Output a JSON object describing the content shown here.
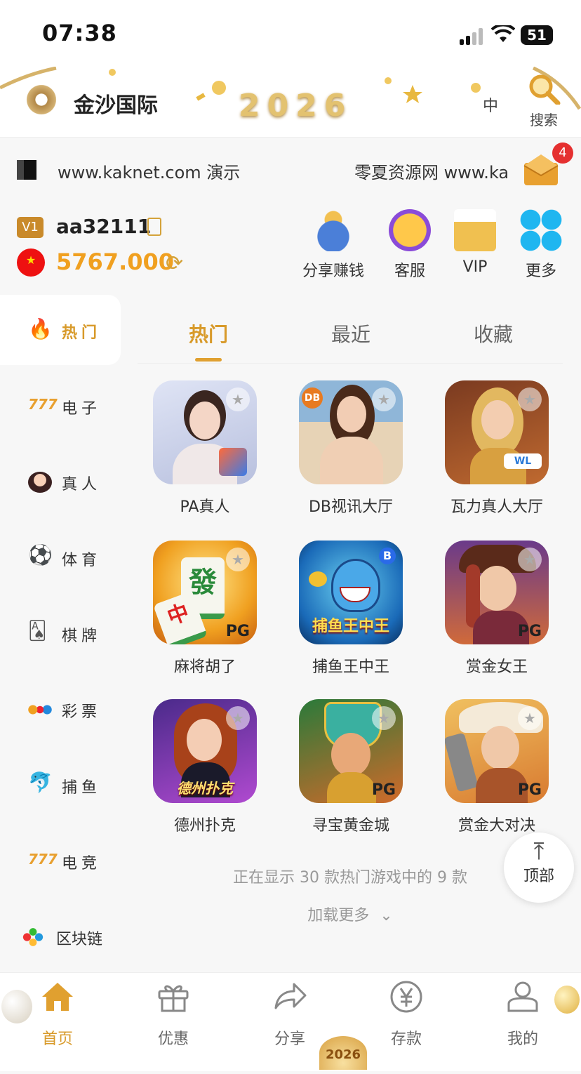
{
  "status": {
    "time": "07:38",
    "battery": "51"
  },
  "header": {
    "brand": "金沙国际",
    "badge": "2026",
    "lang": "中",
    "search_label": "搜索"
  },
  "marquee": {
    "text1": "www.kaknet.com 演示",
    "text2": "零夏资源网 www.ka",
    "mail_count": "4"
  },
  "user": {
    "level": "V1",
    "username": "aa32111",
    "balance": "5767.000"
  },
  "quick_actions": [
    {
      "label": "分享赚钱",
      "icon": "money-bag-icon"
    },
    {
      "label": "客服",
      "icon": "headset-icon"
    },
    {
      "label": "VIP",
      "icon": "crown-icon"
    },
    {
      "label": "更多",
      "icon": "clover-icon"
    }
  ],
  "sidebar": {
    "items": [
      {
        "label": "热门",
        "icon": "fire-icon"
      },
      {
        "label": "电子",
        "icon": "slot-777-icon"
      },
      {
        "label": "真人",
        "icon": "dealer-icon"
      },
      {
        "label": "体育",
        "icon": "soccer-ball-icon"
      },
      {
        "label": "棋牌",
        "icon": "cards-icon"
      },
      {
        "label": "彩票",
        "icon": "lottery-balls-icon"
      },
      {
        "label": "捕鱼",
        "icon": "fish-icon"
      },
      {
        "label": "电竞",
        "icon": "slot-777-icon"
      },
      {
        "label": "区块链",
        "icon": "blockchain-icon"
      }
    ]
  },
  "tabs": [
    {
      "label": "热门"
    },
    {
      "label": "最近"
    },
    {
      "label": "收藏"
    }
  ],
  "games": [
    {
      "name": "PA真人"
    },
    {
      "name": "DB视讯大厅"
    },
    {
      "name": "瓦力真人大厅"
    },
    {
      "name": "麻将胡了",
      "tag": "PG"
    },
    {
      "name": "捕鱼王中王"
    },
    {
      "name": "赏金女王",
      "tag": "PG"
    },
    {
      "name": "德州扑克"
    },
    {
      "name": "寻宝黄金城",
      "tag": "PG"
    },
    {
      "name": "赏金大对决",
      "tag": "PG"
    }
  ],
  "game_count_info": "正在显示 30 款热门游戏中的 9 款",
  "load_more": "加载更多",
  "back_to_top": "顶部",
  "tabbar": [
    {
      "label": "首页"
    },
    {
      "label": "优惠"
    },
    {
      "label": "分享"
    },
    {
      "label": "存款"
    },
    {
      "label": "我的"
    }
  ],
  "colors": {
    "accent": "#d89a2a",
    "balance": "#f0a020",
    "badge": "#e53030"
  }
}
